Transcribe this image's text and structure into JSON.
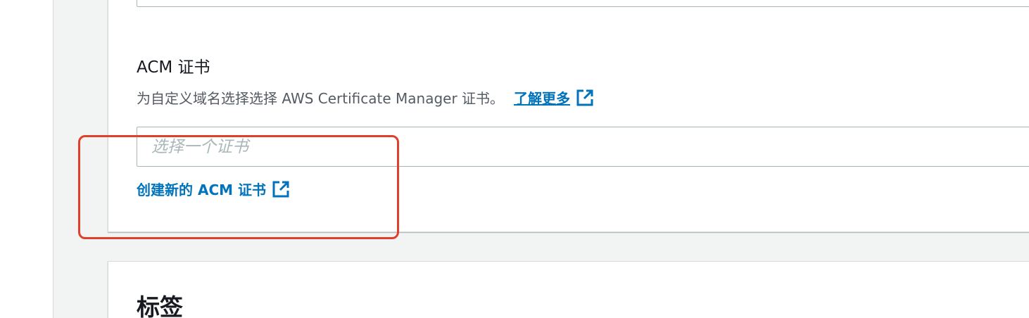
{
  "acm": {
    "label": "ACM 证书",
    "description": "为自定义域名选择选择 AWS Certificate Manager 证书。",
    "learn_more": "了解更多",
    "learn_more_icon": "external-link-icon",
    "input_placeholder": "选择一个证书",
    "input_value": "",
    "create_link": "创建新的 ACM 证书",
    "create_link_icon": "external-link-icon"
  },
  "tags_section": {
    "title": "标签"
  },
  "colors": {
    "link": "#0073bb",
    "highlight": "#e0402a",
    "page_bg": "#f2f3f3"
  }
}
